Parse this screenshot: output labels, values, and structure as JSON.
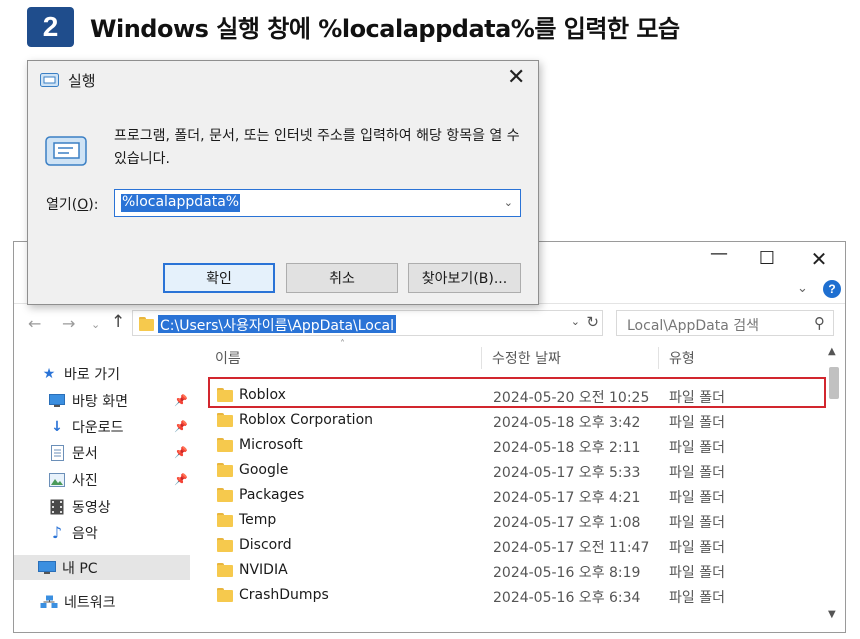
{
  "heading": {
    "step_number": "2",
    "title": "Windows 실행 창에 %localappdata%를 입력한 모습"
  },
  "run_dialog": {
    "title": "실행",
    "description": "프로그램, 폴더, 문서, 또는 인터넷 주소를 입력하여 해당 항목을 열 수 있습니다.",
    "open_label_prefix": "열기(",
    "open_label_key": "O",
    "open_label_suffix": "):",
    "input_value": "%localappdata%",
    "ok_label": "확인",
    "cancel_label": "취소",
    "browse_label": "찾아보기(B)...",
    "close_glyph": "✕"
  },
  "explorer": {
    "window_controls": {
      "minimize": "—",
      "maximize": "☐",
      "close": "✕"
    },
    "help_label": "?",
    "address_path": "C:\\Users\\사용자이름\\AppData\\Local",
    "search_placeholder": "Local\\AppData 검색",
    "nav_pane": {
      "items": [
        {
          "label": "바로 가기",
          "icon": "star-icon",
          "pinned": false
        },
        {
          "label": "바탕 화면",
          "icon": "desktop-icon",
          "pinned": true
        },
        {
          "label": "다운로드",
          "icon": "download-icon",
          "pinned": true
        },
        {
          "label": "문서",
          "icon": "documents-icon",
          "pinned": true
        },
        {
          "label": "사진",
          "icon": "pictures-icon",
          "pinned": true
        },
        {
          "label": "동영상",
          "icon": "videos-icon",
          "pinned": false
        },
        {
          "label": "음악",
          "icon": "music-icon",
          "pinned": false
        },
        {
          "label": "내 PC",
          "icon": "this-pc-icon",
          "pinned": false,
          "selected": true
        },
        {
          "label": "네트워크",
          "icon": "network-icon",
          "pinned": false
        }
      ]
    },
    "columns": {
      "name": "이름",
      "modified": "수정한 날짜",
      "type": "유형"
    },
    "files": [
      {
        "name": "Roblox",
        "modified": "2024-05-20 오전 10:25",
        "type": "파일 폴더",
        "highlighted": true
      },
      {
        "name": "Roblox Corporation",
        "modified": "2024-05-18 오후 3:42",
        "type": "파일 폴더"
      },
      {
        "name": "Microsoft",
        "modified": "2024-05-18 오후 2:11",
        "type": "파일 폴더"
      },
      {
        "name": "Google",
        "modified": "2024-05-17 오후 5:33",
        "type": "파일 폴더"
      },
      {
        "name": "Packages",
        "modified": "2024-05-17 오후 4:21",
        "type": "파일 폴더"
      },
      {
        "name": "Temp",
        "modified": "2024-05-17 오후 1:08",
        "type": "파일 폴더"
      },
      {
        "name": "Discord",
        "modified": "2024-05-17 오전 11:47",
        "type": "파일 폴더"
      },
      {
        "name": "NVIDIA",
        "modified": "2024-05-16 오후 8:19",
        "type": "파일 폴더"
      },
      {
        "name": "CrashDumps",
        "modified": "2024-05-16 오후 6:34",
        "type": "파일 폴더"
      }
    ]
  },
  "colors": {
    "step_badge": "#1f4d8c",
    "selection": "#2a73d6",
    "highlight_border": "#d2262e",
    "folder": "#f6c94d"
  }
}
